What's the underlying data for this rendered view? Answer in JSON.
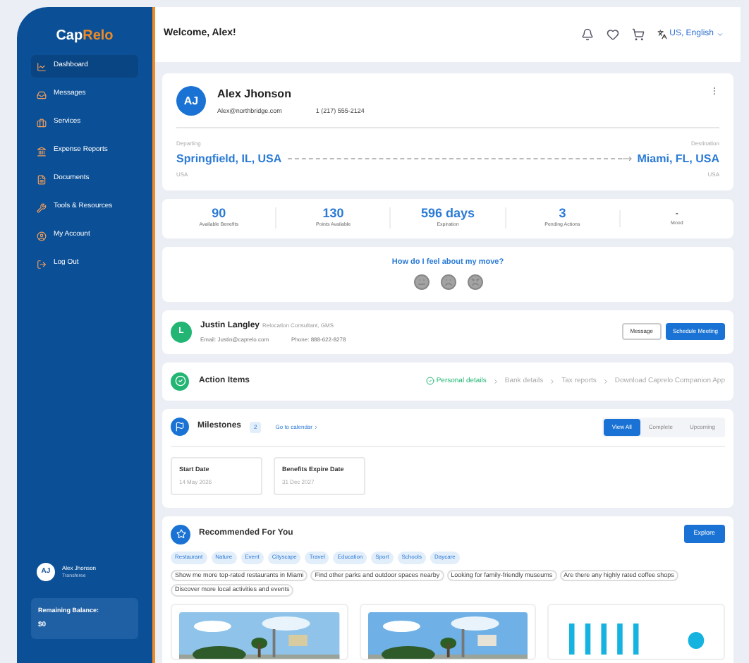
{
  "sidebar": {
    "logo": {
      "part1": "Cap",
      "part2": "Relo"
    },
    "items": [
      {
        "label": "Dashboard",
        "selected": true
      },
      {
        "label": "Messages",
        "selected": false
      },
      {
        "label": "Services",
        "selected": false
      },
      {
        "label": "Expense Reports",
        "selected": false
      },
      {
        "label": "Documents",
        "selected": false
      },
      {
        "label": "Tools & Resources",
        "selected": false
      },
      {
        "label": "My Account",
        "selected": false
      },
      {
        "label": "Log Out",
        "selected": false
      }
    ],
    "user": {
      "initials": "AJ",
      "name": "Alex Jhonson",
      "role": "Transferee"
    },
    "balance": {
      "label": "Remaining Balance:",
      "value": "$0"
    }
  },
  "header": {
    "welcome": "Welcome, Alex!",
    "language": "US, English"
  },
  "profile": {
    "initials": "AJ",
    "name": "Alex Jhonson",
    "email": "Alex@northbridge.com",
    "phone": "1 (217) 555-2124",
    "departing": {
      "label": "Departing",
      "city": "Springfield, IL, USA",
      "country": "USA"
    },
    "destination": {
      "label": "Destination",
      "city": "Miami, FL, USA",
      "country": "USA"
    }
  },
  "stats": [
    {
      "value": "90",
      "label": "Available Benefits"
    },
    {
      "value": "130",
      "label": "Points Available"
    },
    {
      "value": "596 days",
      "label": "Expiration"
    },
    {
      "value": "3",
      "label": "Pending Actions"
    },
    {
      "value": "-",
      "label": "Mood"
    }
  ],
  "mood": {
    "question": "How do I feel about my move?"
  },
  "consultant": {
    "initial": "L",
    "name": "Justin Langley",
    "title": "Relocation Consultant, GMS",
    "email": "Email: Justin@caprelo.com",
    "phone": "Phone: 888-622-8278",
    "buttons": [
      "Message",
      "Schedule Meeting"
    ]
  },
  "action_items": {
    "title": "Action Items",
    "steps": [
      {
        "label": "Personal details",
        "done": true
      },
      {
        "label": "Bank details",
        "done": false
      },
      {
        "label": "Tax reports",
        "done": false
      },
      {
        "label": "Download Caprelo Companion App",
        "done": false
      }
    ]
  },
  "milestones": {
    "title": "Milestones",
    "count": "2",
    "link": "Go to calendar",
    "tabs": [
      {
        "label": "View All",
        "selected": true
      },
      {
        "label": "Complete",
        "selected": false
      },
      {
        "label": "Upcoming",
        "selected": false
      }
    ],
    "items": [
      {
        "title": "Start Date",
        "date": "14 May 2026"
      },
      {
        "title": "Benefits Expire Date",
        "date": "31 Dec 2027"
      }
    ]
  },
  "recommended": {
    "title": "Recommended For You",
    "button": "Explore",
    "tags": [
      "Restaurant",
      "Nature",
      "Event",
      "Cityscape",
      "Travel",
      "Education",
      "Sport",
      "Schools",
      "Daycare"
    ],
    "suggestions": [
      "Show me more top-rated restaurants in Miami",
      "Find other parks and outdoor spaces nearby",
      "Looking for family-friendly museums",
      "Are there any highly rated coffee shops",
      "Discover more local activities and events"
    ]
  }
}
